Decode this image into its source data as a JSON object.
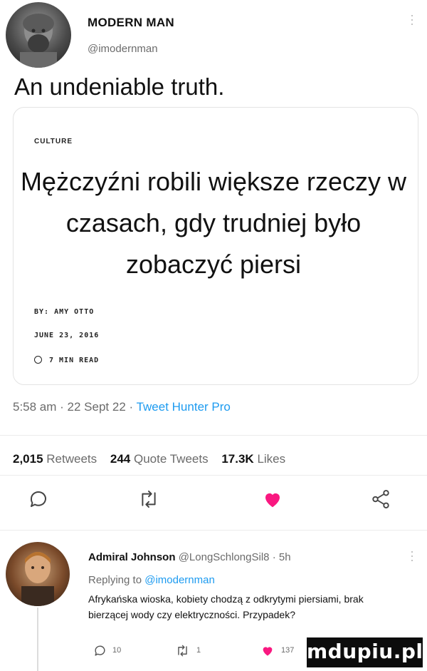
{
  "tweet": {
    "author_name": "MODERN MAN",
    "author_handle": "@imodernman",
    "text": "An undeniable truth.",
    "timestamp": "5:58 am · 22 Sept 22 · ",
    "source": "Tweet Hunter Pro",
    "stats": {
      "retweets_count": "2,015",
      "retweets_label": "Retweets",
      "quotes_count": "244",
      "quotes_label": "Quote Tweets",
      "likes_count": "17.3K",
      "likes_label": "Likes"
    },
    "like_color": "#f91880",
    "link_color": "#1d9bf0"
  },
  "card": {
    "section": "CULTURE",
    "headline": "Mężczyźni robili większe rzeczy w czasach, gdy trudniej było zobaczyć piersi",
    "byline": "BY: AMY OTTO",
    "date": "JUNE 23, 2016",
    "read_time": "7 MIN READ"
  },
  "reply": {
    "author_name": "Admiral Johnson",
    "author_handle": "@LongSchlongSil8",
    "age": "· 5h",
    "replying_prefix": "Replying to",
    "replying_to": "@imodernman",
    "text": "Afrykańska wioska, kobiety chodzą z odkrytymi piersiami, brak bierzącej wody czy elektryczności. Przypadek?",
    "reply_count": "10",
    "retweet_count": "1",
    "like_count": "137"
  },
  "watermark": "mdupiu.pl",
  "icons": [
    "reply-icon",
    "retweet-icon",
    "like-icon",
    "share-icon",
    "clock-icon",
    "more-icon"
  ]
}
